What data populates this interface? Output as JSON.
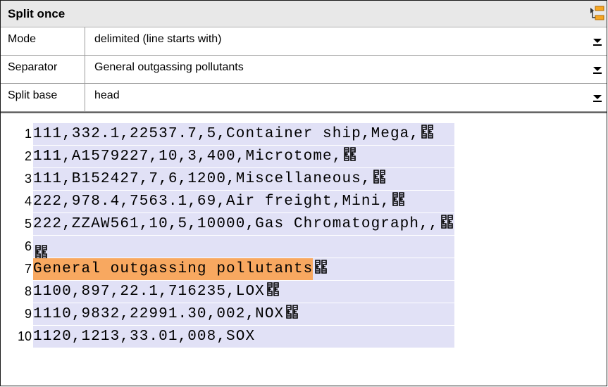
{
  "panel": {
    "title": "Split once",
    "title_icon": "split-component-icon"
  },
  "properties": [
    {
      "label": "Mode",
      "value": "delimited (line starts with)"
    },
    {
      "label": "Separator",
      "value": "General outgassing pollutants"
    },
    {
      "label": "Split base",
      "value": "head"
    }
  ],
  "editor": {
    "highlight_color": "#f8a860",
    "background_color": "#e1e1f6",
    "lines": [
      {
        "num": "1",
        "text": "111,332.1,22537.7,5,Container ship,Mega,",
        "eol": true,
        "highlight": false
      },
      {
        "num": "2",
        "text": "111,A1579227,10,3,400,Microtome,",
        "eol": true,
        "highlight": false
      },
      {
        "num": "3",
        "text": "111,B152427,7,6,1200,Miscellaneous,",
        "eol": true,
        "highlight": false
      },
      {
        "num": "4",
        "text": "222,978.4,7563.1,69,Air freight,Mini,",
        "eol": true,
        "highlight": false
      },
      {
        "num": "5",
        "text": "222,ZZAW561,10,5,10000,Gas Chromatograph,,",
        "eol": true,
        "highlight": false
      },
      {
        "num": "6",
        "text": "",
        "eol": true,
        "highlight": false
      },
      {
        "num": "7",
        "text": "General outgassing pollutants",
        "eol": true,
        "highlight": true
      },
      {
        "num": "8",
        "text": "1100,897,22.1,716235,LOX",
        "eol": true,
        "highlight": false
      },
      {
        "num": "9",
        "text": "1110,9832,22991.30,002,NOX",
        "eol": true,
        "highlight": false
      },
      {
        "num": "10",
        "text": "1120,1213,33.01,008,SOX",
        "eol": false,
        "highlight": false
      }
    ]
  }
}
